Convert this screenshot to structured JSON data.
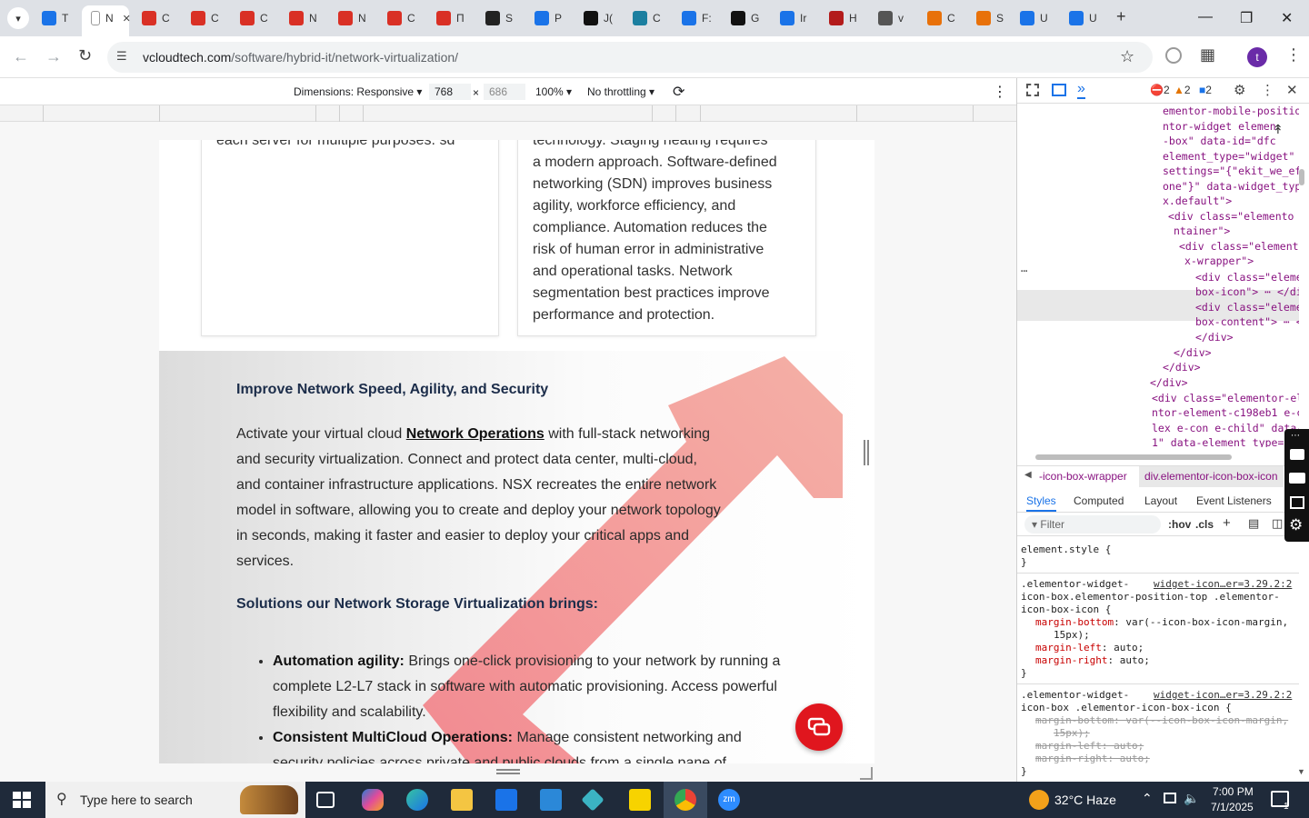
{
  "browser": {
    "tabs": [
      {
        "label": "T",
        "color": "#1a73e8"
      },
      {
        "label": "N",
        "color": "#ffffff",
        "active": true
      },
      {
        "label": "C",
        "color": "#d93025"
      },
      {
        "label": "C",
        "color": "#d93025"
      },
      {
        "label": "C",
        "color": "#d93025"
      },
      {
        "label": "N",
        "color": "#d93025"
      },
      {
        "label": "N",
        "color": "#d93025"
      },
      {
        "label": "C",
        "color": "#d93025"
      },
      {
        "label": "П",
        "color": "#d93025"
      },
      {
        "label": "S",
        "color": "#222222"
      },
      {
        "label": "P",
        "color": "#1a73e8"
      },
      {
        "label": "J(",
        "color": "#111111"
      },
      {
        "label": "C",
        "color": "#1b7fa0"
      },
      {
        "label": "F:",
        "color": "#1a73e8"
      },
      {
        "label": "G",
        "color": "#111111"
      },
      {
        "label": "Ir",
        "color": "#1a73e8"
      },
      {
        "label": "H",
        "color": "#b31b1b"
      },
      {
        "label": "v",
        "color": "#555555"
      },
      {
        "label": "C",
        "color": "#e8710a"
      },
      {
        "label": "S",
        "color": "#e8710a"
      },
      {
        "label": "U",
        "color": "#1a73e8"
      },
      {
        "label": "U",
        "color": "#1a73e8"
      }
    ],
    "new_tab": "+",
    "url_host": "vcloudtech.com",
    "url_path": "/software/hybrid-it/network-virtualization/",
    "profile_initial": "t"
  },
  "device_toolbar": {
    "dimensions_label": "Dimensions: Responsive",
    "width": "768",
    "height": "686",
    "times": "×",
    "zoom": "100%",
    "throttling": "No throttling"
  },
  "page": {
    "card_left_text": "each server for multiple purposes.  sd",
    "card_right_lines": [
      "technology. Staging heating requires",
      "a modern approach. Software-defined",
      "networking (SDN) improves business",
      "agility, workforce efficiency, and",
      "compliance. Automation reduces the",
      "risk of human error in administrative",
      "and operational tasks. Network",
      "segmentation best practices improve",
      "performance and protection."
    ],
    "heading1": "Improve Network Speed, Agility, and Security",
    "para_prefix": " Activate your virtual cloud ",
    "para_link": "Network Operations",
    "para_lines": [
      " with full-stack networking",
      "and security virtualization. Connect and protect data center, multi-cloud,",
      "and container infrastructure applications. NSX recreates the entire network",
      "model in software, allowing you to create and deploy your network topology",
      "in seconds, making it faster and easier to deploy your critical apps and",
      "services."
    ],
    "heading2": "Solutions our Network Storage Virtualization brings:",
    "bullets": [
      {
        "title": "Automation agility:",
        "text": " Brings one-click provisioning to your network by running a complete L2-L7 stack in software with automatic provisioning. Access powerful flexibility and scalability."
      },
      {
        "title": "Consistent MultiCloud Operations:",
        "text": " Manage consistent networking and security policies across private and public clouds from a single pane of"
      }
    ]
  },
  "devtools": {
    "errors": "2",
    "warnings": "2",
    "issues": "2",
    "dom_lines": [
      "ementor-mobile-positio",
      "ntor-widget elemen",
      "-box\" data-id=\"dfc",
      "element_type=\"widget\"",
      "settings=\"{\"ekit_we_ef",
      "one\"}\" data-widget_typ",
      "x.default\">",
      "<div class=\"elemento",
      "ntainer\">",
      "<div class=\"element",
      "x-wrapper\">",
      "<div class=\"eleme",
      "box-icon\"> ⋯ </di",
      "<div class=\"eleme",
      "box-content\"> ⋯ <",
      "</div>",
      "</div>",
      "</div>",
      "</div>",
      "<div class=\"elementor-el",
      "ntor-element-c198eb1 e-c",
      "lex e-con e-child\" data-",
      "1\" data-element_type=\""
    ],
    "crumb1": "-icon-box-wrapper",
    "crumb2": "div.elementor-icon-box-icon",
    "subtabs": [
      "Styles",
      "Computed",
      "Layout",
      "Event Listeners"
    ],
    "filter_placeholder": "Filter",
    "hov": ":hov",
    "cls": ".cls",
    "style_lines": {
      "element_style": "element.style {",
      "close": "}",
      "rule1_selector_a": ".elementor-widget-",
      "rule1_source": "widget-icon…er=3.29.2:2",
      "rule1_selector_b": "icon-box.elementor-position-top .elementor-",
      "rule1_selector_c": "icon-box-icon {",
      "rule1_p1_name": "margin-bottom",
      "rule1_p1_val": ": var(--icon-box-icon-margin,",
      "rule1_p1_val2": "15px);",
      "rule1_p2_name": "margin-left",
      "rule1_p2_val": ": auto;",
      "rule1_p3_name": "margin-right",
      "rule1_p3_val": ": auto;",
      "rule2_selector_a": ".elementor-widget-",
      "rule2_source": "widget-icon…er=3.29.2:2",
      "rule2_selector_b": "icon-box .elementor-icon-box-icon {",
      "rule2_p1": "margin-bottom: var(--icon-box-icon-margin,",
      "rule2_p1b": "15px);",
      "rule2_p2": "margin-left: auto;",
      "rule2_p3": "margin-right: auto;"
    }
  },
  "taskbar": {
    "search_placeholder": "Type here to search",
    "weather": "32°C  Haze",
    "time": "7:00 PM",
    "date": "7/1/2025",
    "notification_count": "1"
  },
  "colors": {
    "accent_red": "#e0161e",
    "heading_navy": "#1c2d4a",
    "arrow_pink": "#f08a8a"
  }
}
